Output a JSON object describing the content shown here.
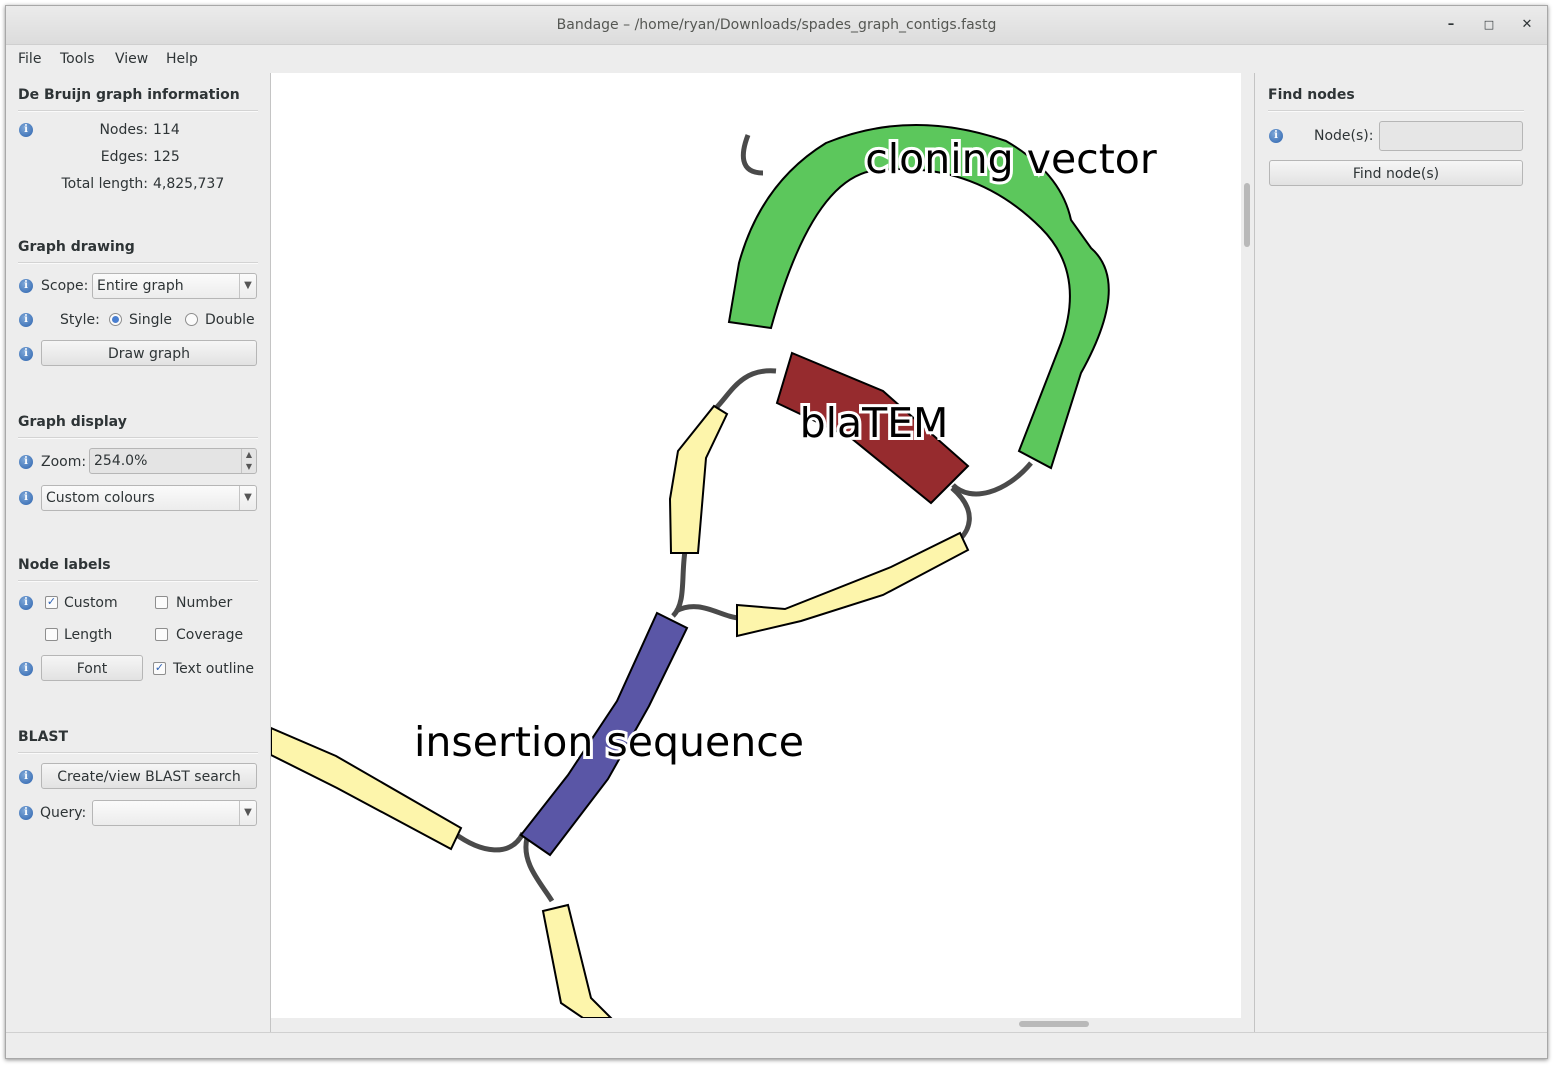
{
  "window": {
    "title": "Bandage – /home/ryan/Downloads/spades_graph_contigs.fastg",
    "minimize_icon": "minimize-icon",
    "maximize_icon": "maximize-icon",
    "close_icon": "close-icon"
  },
  "menu": [
    "File",
    "Tools",
    "View",
    "Help"
  ],
  "graph_info": {
    "title": "De Bruijn graph information",
    "nodes_label": "Nodes:",
    "nodes_value": "114",
    "edges_label": "Edges:",
    "edges_value": "125",
    "length_label": "Total length:",
    "length_value": "4,825,737"
  },
  "graph_drawing": {
    "title": "Graph drawing",
    "scope_label": "Scope:",
    "scope_value": "Entire graph",
    "style_label": "Style:",
    "style_single": "Single",
    "style_double": "Double",
    "style_selected": "Single",
    "draw_button": "Draw graph"
  },
  "graph_display": {
    "title": "Graph display",
    "zoom_label": "Zoom:",
    "zoom_value": "254.0%",
    "colour_scheme": "Custom colours"
  },
  "node_labels": {
    "title": "Node labels",
    "custom": "Custom",
    "custom_checked": true,
    "number": "Number",
    "number_checked": false,
    "length": "Length",
    "length_checked": false,
    "coverage": "Coverage",
    "coverage_checked": false,
    "font_button": "Font",
    "text_outline": "Text outline",
    "text_outline_checked": true
  },
  "blast": {
    "title": "BLAST",
    "search_button": "Create/view BLAST search",
    "query_label": "Query:",
    "query_value": ""
  },
  "find_nodes": {
    "title": "Find nodes",
    "nodes_label": "Node(s):",
    "nodes_value": "",
    "find_button": "Find node(s)"
  },
  "graph": {
    "labels": {
      "cloning_vector": "cloning vector",
      "blatem": "blaTEM",
      "insertion_sequence": "insertion sequence"
    },
    "colors": {
      "cloning_vector": "#5cc75c",
      "blatem": "#962b2e",
      "insertion_sequence": "#5a56a6",
      "default_node": "#fdf5ab",
      "edge": "#4a4a4a",
      "outline": "#000000"
    }
  }
}
